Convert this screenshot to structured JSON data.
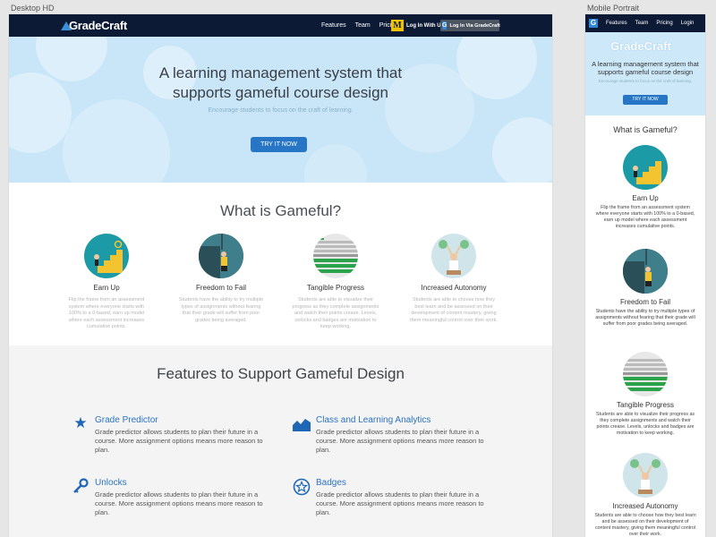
{
  "canvas": {
    "desktop_label": "Desktop HD",
    "mobile_label": "Mobile Portrait"
  },
  "desktop": {
    "nav": {
      "logo": "GradeCraft",
      "links": [
        "Features",
        "Team",
        "Pricing"
      ],
      "um_logo": "M",
      "um_button": "Log In With UM",
      "gc_button": "Log In Via GradeCraft"
    },
    "hero": {
      "title": "A learning management system that supports gameful course design",
      "subtitle": "Encourage students to focus on the craft of learning.",
      "cta": "TRY IT NOW"
    },
    "gameful": {
      "heading": "What is Gameful?",
      "items": [
        {
          "title": "Earn Up",
          "desc": "Flip the frame from an assessment system where everyone starts with 100% to a 0-based, earn up model where each assessment increases cumulative points."
        },
        {
          "title": "Freedom to Fail",
          "desc": "Students have the ability to try multiple types of assignments without fearing that their grade will suffer from poor grades being averaged."
        },
        {
          "title": "Tangible Progress",
          "desc": "Students are able to visualize their progress as they complete assignments and watch their points crease. Levels, unlocks and badges are motivation to keep working."
        },
        {
          "title": "Increased Autonomy",
          "desc": "Students are able to choose how they best learn and be assessed on their development of content mastery, giving them meaningful control over their work."
        }
      ]
    },
    "features": {
      "heading": "Features to Support Gameful Design",
      "items": [
        {
          "title": "Grade Predictor",
          "desc": "Grade predictor allows students to plan their future in a course. More assignment options means more reason to plan.",
          "icon": "star-icon"
        },
        {
          "title": "Class and Learning Analytics",
          "desc": "Grade predictor allows students to plan their future in a course. More assignment options means more reason to plan.",
          "icon": "chart-icon"
        },
        {
          "title": "Unlocks",
          "desc": "Grade predictor allows students to plan their future in a course. More assignment options means more reason to plan.",
          "icon": "key-icon"
        },
        {
          "title": "Badges",
          "desc": "Grade predictor allows students to plan their future in a course. More assignment options means more reason to plan.",
          "icon": "badge-icon"
        }
      ]
    }
  },
  "mobile": {
    "nav": {
      "logo_glyph": "G",
      "links": [
        "Features",
        "Team",
        "Pricing",
        "Login"
      ]
    },
    "hero": {
      "logo": "GradeCraft",
      "title": "A learning management system that supports gameful course design",
      "subtitle": "Encourage students to focus on the craft of learning.",
      "cta": "TRY IT NOW"
    },
    "heading": "What is Gameful?",
    "items": [
      {
        "title": "Earn Up",
        "desc": "Flip the frame from an assessment system where everyone starts with 100% to a 0-based, earn up model where each assessment increases cumulative points."
      },
      {
        "title": "Freedom to Fail",
        "desc": "Students have the ability to try multiple types of assignments without fearing that their grade will suffer from poor grades being averaged."
      },
      {
        "title": "Tangible Progress",
        "desc": "Students are able to visualize their progress as they complete assignments and watch their points crease. Levels, unlocks and badges are motivation to keep working."
      },
      {
        "title": "Increased Autonomy",
        "desc": "Students are able to choose how they best learn and be assessed on their development of content mastery, giving them meaningful control over their work."
      }
    ]
  },
  "colors": {
    "nav": "#0c1a36",
    "accent": "#2776c6",
    "hero": "#c9e6f8",
    "um_gold": "#f2c200"
  }
}
